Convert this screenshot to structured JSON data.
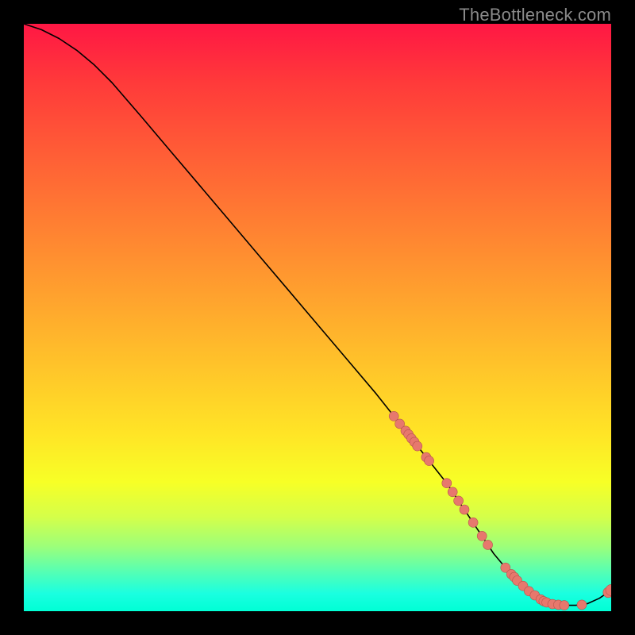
{
  "watermark": "TheBottleneck.com",
  "colors": {
    "curve": "#000000",
    "dot_fill": "#e7786d",
    "dot_stroke": "#b5554c"
  },
  "chart_data": {
    "type": "line",
    "title": "",
    "xlabel": "",
    "ylabel": "",
    "xlim": [
      0,
      100
    ],
    "ylim": [
      0,
      100
    ],
    "grid": false,
    "legend": false,
    "series": [
      {
        "name": "curve",
        "x": [
          0,
          3,
          6,
          9,
          12,
          15,
          20,
          25,
          30,
          35,
          40,
          45,
          50,
          55,
          60,
          63,
          66,
          69,
          72,
          74,
          76,
          78,
          80,
          82,
          84,
          86,
          88,
          90,
          92,
          94,
          96,
          98,
          99,
          100
        ],
        "y": [
          100,
          99,
          97.5,
          95.5,
          93,
          90,
          84.2,
          78.3,
          72.4,
          66.5,
          60.6,
          54.7,
          48.8,
          42.9,
          37,
          33.2,
          29.4,
          25.6,
          21.8,
          18.8,
          15.8,
          12.8,
          9.8,
          7.4,
          5.2,
          3.4,
          2.0,
          1.2,
          1.0,
          1.0,
          1.3,
          2.2,
          2.9,
          3.6
        ]
      }
    ],
    "points": {
      "name": "dots",
      "x": [
        63,
        64,
        65,
        65.5,
        66,
        66.5,
        67,
        68.5,
        69,
        72,
        73,
        74,
        75,
        76.5,
        78,
        79,
        82,
        83,
        83.5,
        84,
        85,
        86,
        87,
        88,
        88.5,
        89,
        90,
        91,
        92,
        95,
        99.5,
        100
      ],
      "y": [
        33.2,
        31.9,
        30.7,
        30.1,
        29.4,
        28.8,
        28.1,
        26.2,
        25.6,
        21.8,
        20.3,
        18.8,
        17.3,
        15.1,
        12.8,
        11.3,
        7.4,
        6.3,
        5.8,
        5.2,
        4.3,
        3.4,
        2.7,
        2.0,
        1.7,
        1.5,
        1.2,
        1.1,
        1.0,
        1.1,
        3.2,
        3.6
      ],
      "r": [
        6,
        6,
        6,
        6,
        6,
        6,
        6,
        6,
        6,
        6,
        6,
        6,
        6,
        6,
        6,
        6,
        6,
        6,
        6,
        6,
        6,
        6,
        6,
        6,
        6,
        6,
        6,
        6,
        6,
        6,
        6.5,
        7
      ]
    }
  }
}
